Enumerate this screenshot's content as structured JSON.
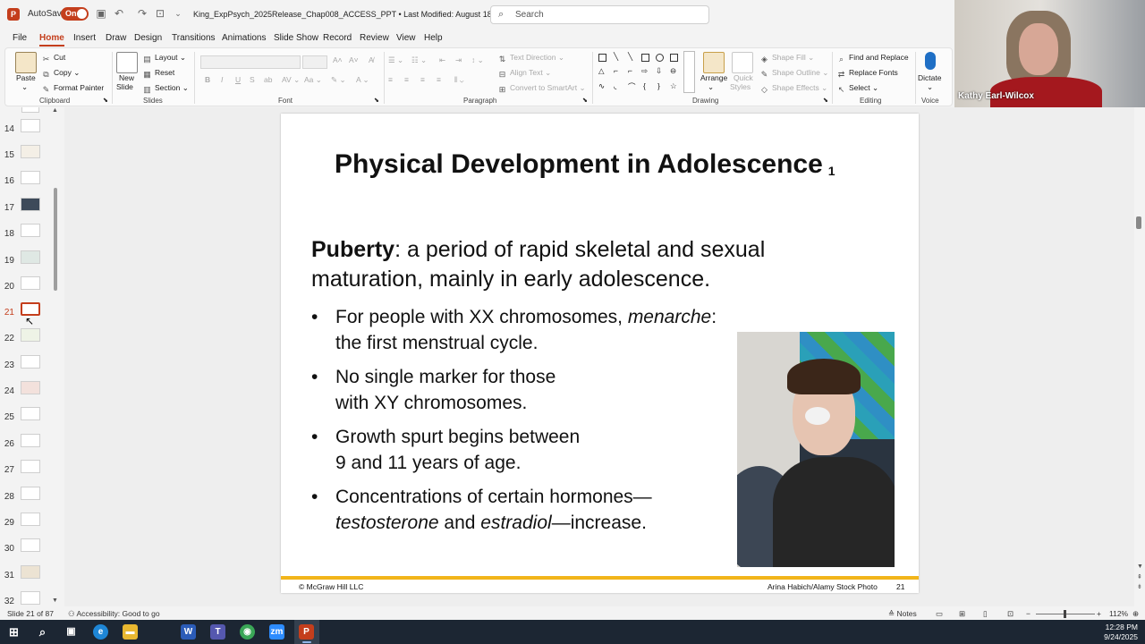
{
  "titlebar": {
    "app_icon": "P",
    "autosave_label": "AutoSave",
    "autosave_state": "On",
    "doc_title": "King_ExpPsych_2025Release_Chap008_ACCESS_PPT • Last Modified: August 18 ⌄",
    "search_placeholder": "Search"
  },
  "tabs": [
    "File",
    "Home",
    "Insert",
    "Draw",
    "Design",
    "Transitions",
    "Animations",
    "Slide Show",
    "Record",
    "Review",
    "View",
    "Help"
  ],
  "ribbon": {
    "clipboard": {
      "paste": "Paste",
      "cut": "Cut",
      "copy": "Copy",
      "format_painter": "Format Painter",
      "label": "Clipboard"
    },
    "slides": {
      "new_slide": "New",
      "new_slide2": "Slide",
      "layout": "Layout",
      "reset": "Reset",
      "section": "Section",
      "label": "Slides"
    },
    "font": {
      "label": "Font"
    },
    "paragraph": {
      "text_direction": "Text Direction",
      "align_text": "Align Text",
      "convert_smartart": "Convert to SmartArt",
      "label": "Paragraph"
    },
    "drawing": {
      "arrange": "Arrange",
      "quick_styles": "Quick",
      "quick_styles2": "Styles",
      "shape_fill": "Shape Fill",
      "shape_outline": "Shape Outline",
      "shape_effects": "Shape Effects",
      "label": "Drawing"
    },
    "editing": {
      "find_replace": "Find and Replace",
      "replace_fonts": "Replace Fonts",
      "select": "Select",
      "label": "Editing"
    },
    "voice": {
      "dictate": "Dictate",
      "label": "Voice"
    }
  },
  "webcam": {
    "name": "Kathy Earl-Wilcox"
  },
  "thumbnails": {
    "numbers": [
      "14",
      "15",
      "16",
      "17",
      "18",
      "19",
      "20",
      "21",
      "22",
      "23",
      "24",
      "25",
      "26",
      "27",
      "28",
      "29",
      "30",
      "31",
      "32"
    ],
    "selected": "21"
  },
  "slide": {
    "title": "Physical Development in Adolescence",
    "title_sub": "1",
    "main_bold": "Puberty",
    "main_rest_1": ": a period of rapid skeletal and sexual",
    "main_rest_2": "maturation, mainly in early adolescence.",
    "bullet_char": "•",
    "b1_l1a": "For people with XX chromosomes, ",
    "b1_l1b": "menarche",
    "b1_l1c": ":",
    "b1_l2": "the first menstrual cycle.",
    "b2_l1": "No single marker for those",
    "b2_l2": "with XY chromosomes.",
    "b3_l1": "Growth spurt begins between",
    "b3_l2": "9 and 11 years of age.",
    "b4_l1": "Concentrations of certain hormones—",
    "b4_l2a": "testosterone",
    "b4_l2b": " and ",
    "b4_l2c": "estradiol",
    "b4_l2d": "—increase.",
    "footer_left": "© McGraw Hill LLC",
    "footer_credit": "Arina Habich/Alamy Stock Photo",
    "footer_page": "21"
  },
  "status": {
    "slide_count": "Slide 21 of 87",
    "accessibility": "Accessibility: Good to go",
    "notes": "Notes",
    "zoom": "112%"
  },
  "taskbar": {
    "time": "12:28 PM",
    "date": "9/24/2025"
  },
  "colors": {
    "accent": "#c43e1c",
    "gold_bar": "#f2b51a",
    "taskbar": "#1c2633"
  }
}
